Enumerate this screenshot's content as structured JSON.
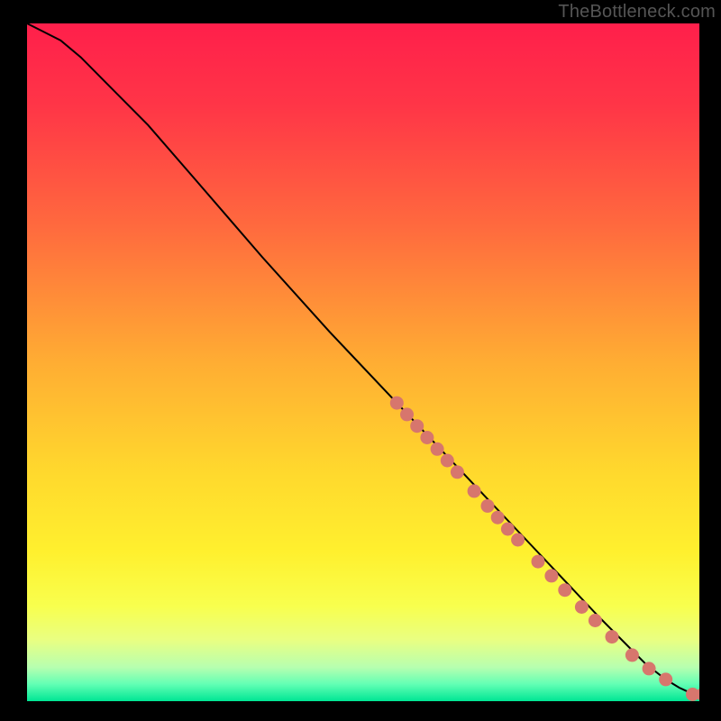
{
  "watermark": "TheBottleneck.com",
  "colors": {
    "background": "#000000",
    "curve": "#000000",
    "points": "#d7766d",
    "gradient_stops": [
      {
        "offset": 0.0,
        "color": "#ff1f4b"
      },
      {
        "offset": 0.12,
        "color": "#ff3547"
      },
      {
        "offset": 0.3,
        "color": "#ff6a3e"
      },
      {
        "offset": 0.5,
        "color": "#ffad33"
      },
      {
        "offset": 0.66,
        "color": "#ffd82d"
      },
      {
        "offset": 0.78,
        "color": "#fff02e"
      },
      {
        "offset": 0.86,
        "color": "#f8ff4e"
      },
      {
        "offset": 0.91,
        "color": "#e9ff82"
      },
      {
        "offset": 0.95,
        "color": "#b7ffb0"
      },
      {
        "offset": 0.975,
        "color": "#62ffb4"
      },
      {
        "offset": 1.0,
        "color": "#00e694"
      }
    ]
  },
  "chart_data": {
    "type": "line",
    "xlabel": "",
    "ylabel": "",
    "xlim": [
      0,
      100
    ],
    "ylim": [
      0,
      100
    ],
    "series": [
      {
        "name": "curve",
        "x": [
          0,
          2,
          5,
          8,
          12,
          18,
          25,
          35,
          45,
          55,
          65,
          75,
          85,
          92,
          95,
          97,
          98.5,
          99.3,
          100
        ],
        "y": [
          100,
          99,
          97.5,
          95,
          91,
          85,
          77,
          65.5,
          54.5,
          44,
          33.5,
          23,
          12.5,
          5.5,
          3.2,
          2.0,
          1.3,
          1.0,
          1.0
        ]
      }
    ],
    "points": [
      {
        "x": 55.0,
        "y": 44.0
      },
      {
        "x": 56.5,
        "y": 42.3
      },
      {
        "x": 58.0,
        "y": 40.6
      },
      {
        "x": 59.5,
        "y": 38.9
      },
      {
        "x": 61.0,
        "y": 37.2
      },
      {
        "x": 62.5,
        "y": 35.5
      },
      {
        "x": 64.0,
        "y": 33.8
      },
      {
        "x": 66.5,
        "y": 31.0
      },
      {
        "x": 68.5,
        "y": 28.8
      },
      {
        "x": 70.0,
        "y": 27.1
      },
      {
        "x": 71.5,
        "y": 25.4
      },
      {
        "x": 73.0,
        "y": 23.8
      },
      {
        "x": 76.0,
        "y": 20.6
      },
      {
        "x": 78.0,
        "y": 18.5
      },
      {
        "x": 80.0,
        "y": 16.4
      },
      {
        "x": 82.5,
        "y": 13.9
      },
      {
        "x": 84.5,
        "y": 11.9
      },
      {
        "x": 87.0,
        "y": 9.5
      },
      {
        "x": 90.0,
        "y": 6.8
      },
      {
        "x": 92.5,
        "y": 4.8
      },
      {
        "x": 95.0,
        "y": 3.2
      },
      {
        "x": 99.0,
        "y": 1.0
      },
      {
        "x": 100.5,
        "y": 1.0
      }
    ]
  }
}
